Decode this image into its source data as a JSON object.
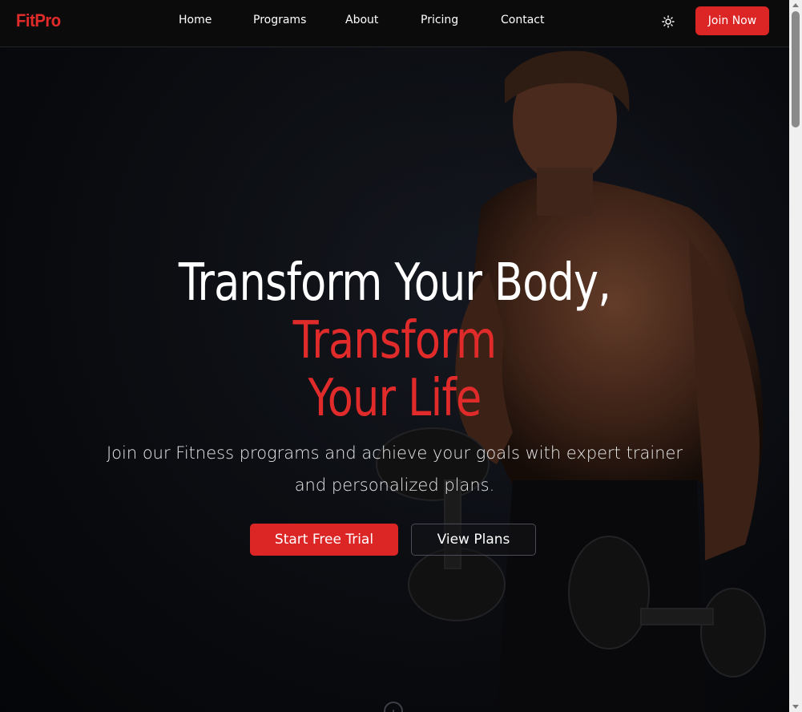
{
  "brand": {
    "logo_text": "FitPro",
    "accent_color": "#dc2626"
  },
  "nav": {
    "items": [
      {
        "label": "Home"
      },
      {
        "label": "Programs"
      },
      {
        "label": "About"
      },
      {
        "label": "Pricing"
      },
      {
        "label": "Contact"
      }
    ],
    "theme_icon": "sun-icon",
    "join_label": "Join Now"
  },
  "hero": {
    "title_white": "Transform Your Body,",
    "title_red_1": "Transform",
    "title_red_2": "Your Life",
    "subtitle": "Join our Fitness programs and achieve your goals with expert trainer and personalized plans.",
    "primary_cta": "Start Free Trial",
    "secondary_cta": "View Plans",
    "background_image": "muscular man holding dumbbells on dark background",
    "scroll_icon": "mouse-scroll-icon"
  }
}
